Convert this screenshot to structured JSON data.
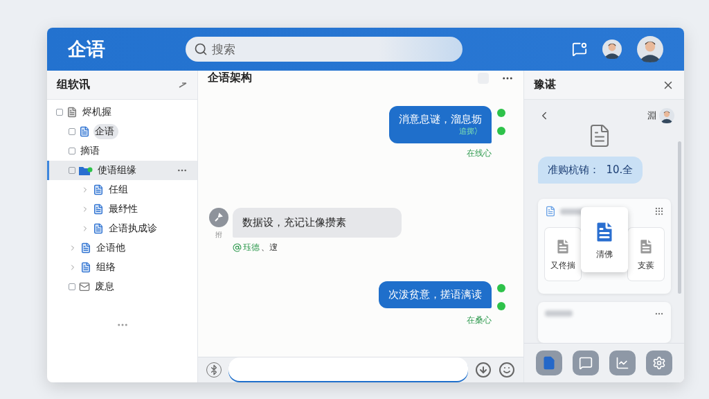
{
  "app": {
    "logo": "企语",
    "search": {
      "placeholder": "搜索"
    }
  },
  "sidebar": {
    "title": "组软讯",
    "tree": [
      {
        "label": "烬机握",
        "kind": "doc-grey",
        "selected": false,
        "focused": false,
        "children": [
          {
            "label": "企语",
            "kind": "doc",
            "selected": false,
            "focused": true
          },
          {
            "label": "摘语",
            "kind": "plain",
            "selected": false,
            "focused": false
          },
          {
            "label": "使语组缘",
            "kind": "team",
            "selected": true,
            "focused": false,
            "children": [
              {
                "label": "任组",
                "kind": "doc",
                "selected": false,
                "focused": false,
                "expanded": false
              },
              {
                "label": "最纾性",
                "kind": "doc",
                "selected": false,
                "focused": false,
                "expanded": false
              },
              {
                "label": "企语执成诊",
                "kind": "doc",
                "selected": false,
                "focused": false,
                "expanded": false
              }
            ]
          },
          {
            "label": "企语他",
            "kind": "doc",
            "selected": false,
            "focused": false,
            "expanded": false
          },
          {
            "label": "组络",
            "kind": "doc",
            "selected": false,
            "focused": false,
            "expanded": false
          },
          {
            "label": "废息",
            "kind": "mail",
            "selected": false,
            "focused": false
          }
        ]
      }
    ]
  },
  "chat": {
    "title": "企语架构",
    "messages": [
      {
        "kind": "out",
        "text": "消意息谜，溜息坜",
        "note": "追掷冫",
        "status": "在线心"
      },
      {
        "kind": "in",
        "sender": "拊",
        "text": "数据设，充记让像攒素",
        "mention": "珏德",
        "tail": "、遚"
      },
      {
        "kind": "out",
        "text": "次泼贫意，搓语漓读",
        "status": "在桑心"
      }
    ]
  },
  "details": {
    "title": "豫谌",
    "contact": "淵",
    "bubble": "准购杭铕：  10.全",
    "files": [
      {
        "label": "又佟揣",
        "selected": false
      },
      {
        "label": "清佛",
        "selected": true
      },
      {
        "label": "支蒺",
        "selected": false
      }
    ],
    "tools": [
      {
        "kind": "document",
        "selected": true
      },
      {
        "kind": "chat",
        "selected": false
      },
      {
        "kind": "chart",
        "selected": false
      },
      {
        "kind": "settings",
        "selected": false
      }
    ]
  }
}
